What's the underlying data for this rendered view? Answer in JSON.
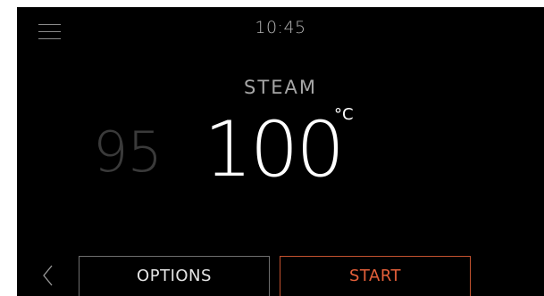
{
  "header": {
    "menu_icon": "hamburger-menu-icon",
    "time": "10:45"
  },
  "mode": {
    "label": "STEAM"
  },
  "temperature": {
    "previous_partial": ")",
    "previous": "95",
    "current": "100",
    "unit": "°C"
  },
  "footer": {
    "back_icon": "chevron-left-icon",
    "options_label": "OPTIONS",
    "start_label": "START"
  },
  "colors": {
    "background": "#000000",
    "accent": "#e5603a",
    "text": "#ffffff",
    "muted_text": "#a6a6a6"
  }
}
